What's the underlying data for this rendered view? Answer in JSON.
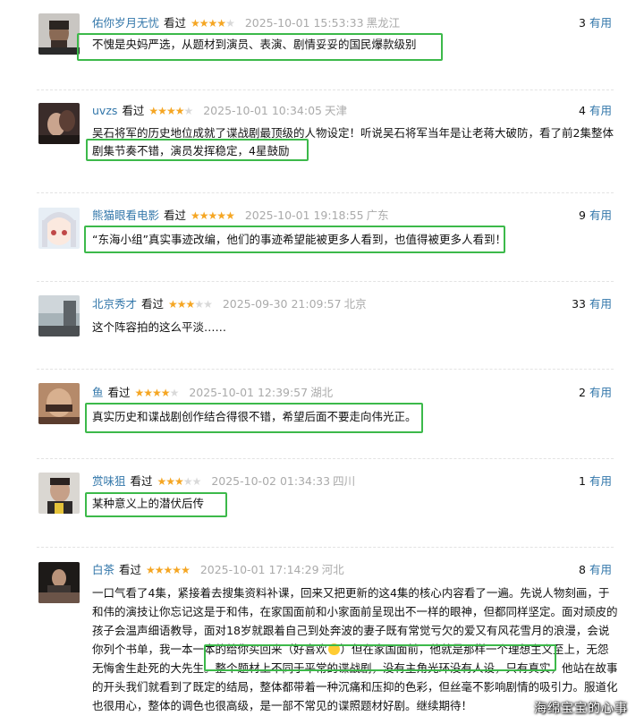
{
  "rating_text": "看过",
  "useful_suffix": "有用",
  "reviews": [
    {
      "user": "佑你岁月无忧",
      "stars": 4,
      "time": "2025-10-01 15:53:33",
      "location": "黑龙江",
      "useful": "3",
      "lines": [
        "不愧是央妈严选，从题材到演员、表演、剧情妥妥的国民爆款级别"
      ]
    },
    {
      "user": "uvzs",
      "stars": 4,
      "time": "2025-10-01 10:34:05",
      "location": "天津",
      "useful": "4",
      "lines": [
        "吴石将军的历史地位成就了谍战剧最顶级的人物设定！听说吴石将军当年是让老蒋大破防，看了前2集整体",
        "剧集节奏不错，演员发挥稳定，4星鼓励"
      ]
    },
    {
      "user": "熊猫眼看电影",
      "stars": 5,
      "time": "2025-10-01 19:18:55",
      "location": "广东",
      "useful": "9",
      "lines": [
        "“东海小组”真实事迹改编，他们的事迹希望能被更多人看到，也值得被更多人看到！"
      ]
    },
    {
      "user": "北京秀才",
      "stars": 3,
      "time": "2025-09-30 21:09:57",
      "location": "北京",
      "useful": "33",
      "lines": [
        "这个阵容拍的这么平淡……"
      ]
    },
    {
      "user": "鱼",
      "stars": 4,
      "time": "2025-10-01 12:39:57",
      "location": "湖北",
      "useful": "2",
      "lines": [
        "真实历史和谍战剧创作结合得很不错，希望后面不要走向伟光正。"
      ]
    },
    {
      "user": "赏味狙",
      "stars": 3,
      "time": "2025-10-02 01:34:33",
      "location": "四川",
      "useful": "1",
      "lines": [
        "某种意义上的潜伏后传"
      ]
    },
    {
      "user": "白茶",
      "stars": 5,
      "time": "2025-10-01 17:14:29",
      "location": "河北",
      "useful": "8",
      "lines": [
        "一口气看了4集，紧接着去搜集资料补课，回来又把更新的这4集的核心内容看了一遍。先说人物刻画，于",
        "和伟的演技让你忘记这是于和伟，在家国面前和小家面前呈现出不一样的眼神，但都同样坚定。面对顽皮的",
        "孩子会温声细语教导，面对18岁就跟着自己到处奔波的妻子既有常觉亏欠的爱又有风花雪月的浪漫，会说",
        "你列个书单，我一本一本的给你买回来（好喜欢",
        "）但在家国面前，他就是那样一个理想主义至上，无怨",
        "无悔舍生赴死的大先生。整个题材上不同于平常的谍战剧，没有主角光环没有人设，只有真实，他站在故事",
        "的开头我们就看到了既定的结局，整体都带着一种沉痛和压抑的色彩，但丝毫不影响剧情的吸引力。服道化",
        "也很用心，整体的调色也很高级，是一部不常见的谍照题材好剧。继续期待！"
      ]
    }
  ],
  "watermark": "海绵宝宝的心事"
}
